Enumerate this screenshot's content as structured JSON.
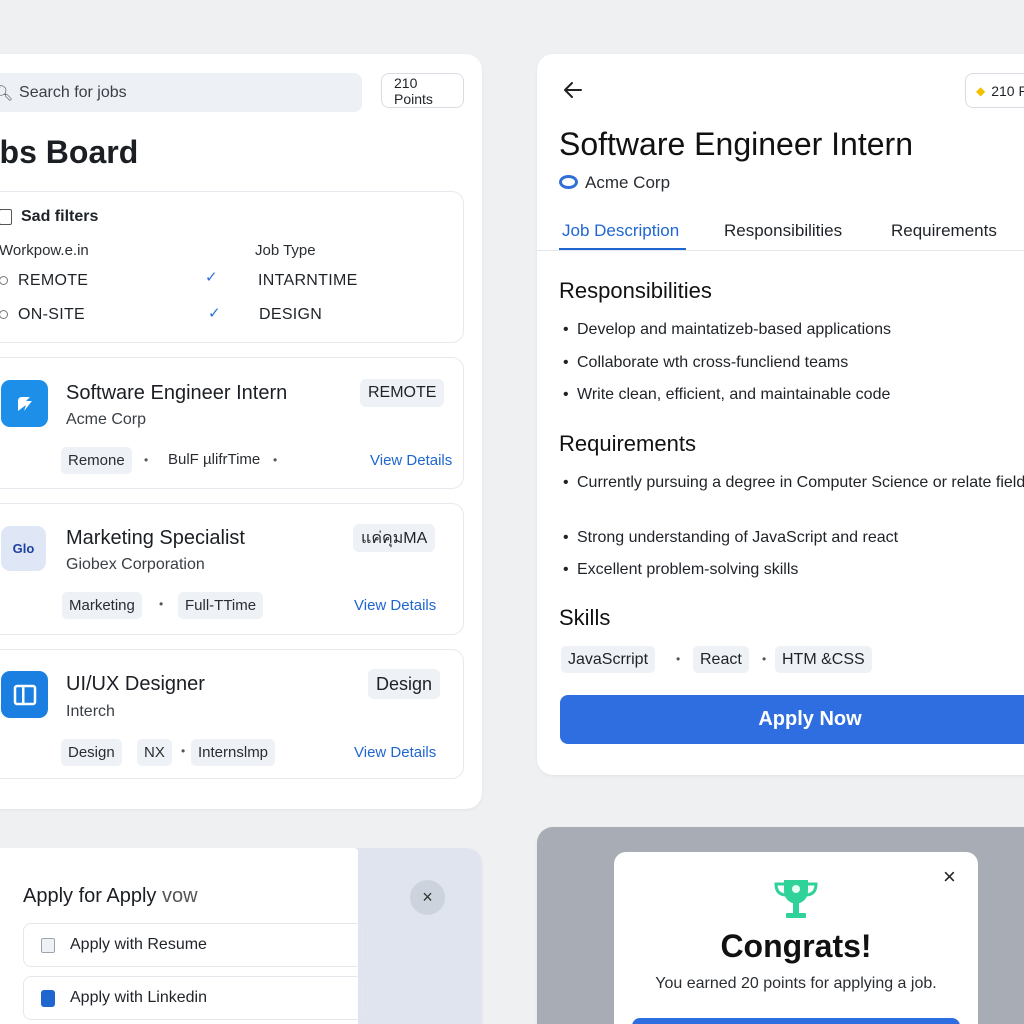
{
  "jobs_board": {
    "search_placeholder": "Search for jobs",
    "points": "210 Points",
    "title": "obs Board",
    "filters": {
      "title": "Sad filters",
      "col1_header": "Workpow.e.in",
      "col2_header": "Job Type",
      "col1_options": [
        "REMOTE",
        "ON-SITE"
      ],
      "col2_options": [
        "INTARNTIME",
        "DESIGN"
      ]
    },
    "jobs": [
      {
        "title": "Software Engineer Intern",
        "company": "Acme Corp",
        "badge": "REMOTE",
        "tags": [
          "Remone",
          "BulF µlifrTime"
        ],
        "link": "View Details"
      },
      {
        "title": "Marketing Specialist",
        "company": "Giobex Corporation",
        "badge": "แค่คุมMA",
        "logo_text": "Glo",
        "tags": [
          "Marketing",
          "Full-TTime"
        ],
        "link": "View Details"
      },
      {
        "title": "UI/UX Designer",
        "company": "Interch",
        "badge": "Design",
        "tags": [
          "Design",
          "NX",
          "Internslmp"
        ],
        "link": "View Details"
      }
    ]
  },
  "job_detail": {
    "points": "210 P",
    "title": "Software Engineer Intern",
    "company": "Acme Corp",
    "tabs": [
      "Job Description",
      "Responsibilities",
      "Requirements"
    ],
    "responsibilities_heading": "Responsibilities",
    "responsibilities": [
      "Develop and maintatizeb-based applications",
      "Collaborate wth cross-funcliend teams",
      "Write clean, efficient, and maintainable  code"
    ],
    "requirements_heading": "Requirements",
    "requirements": [
      "Currently pursuing a degree in Computer Science or relate field.",
      "Strong understanding of JavaScript and react",
      "Excellent problem-solving skills"
    ],
    "skills_heading": "Skills",
    "skills": [
      "JavaScrript",
      "React",
      "HTM &CSS"
    ],
    "apply_button": "Apply Now"
  },
  "apply_modal": {
    "title": "Apply for Apply",
    "title_suffix": "vow",
    "options": [
      "Apply with Resume",
      "Apply with Linkedin"
    ],
    "close": "×"
  },
  "congrats": {
    "title": "Congrats!",
    "message": "You earned 20 points for applying a job.",
    "close": "×"
  },
  "colors": {
    "primary": "#2f6ee0",
    "link": "#1f66d1",
    "trophy": "#2fd39a",
    "star": "#f2c200"
  }
}
